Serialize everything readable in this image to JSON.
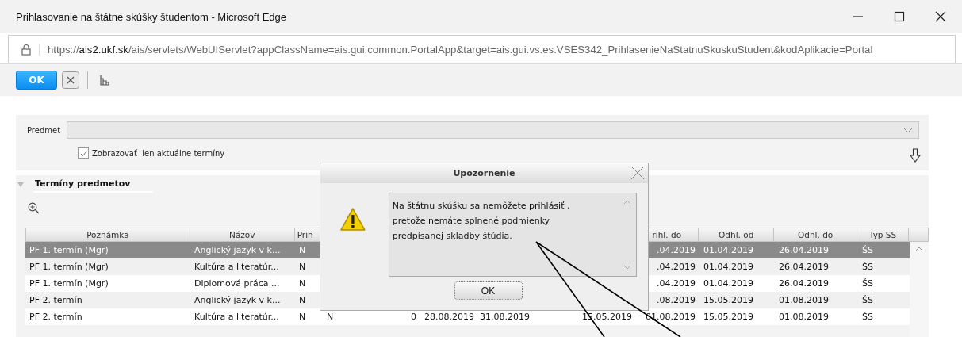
{
  "browser": {
    "title": "Prihlasovanie na štátne skúšky študentom - Microsoft Edge",
    "url_prefix": "https://",
    "url_host": "ais2.ukf.sk",
    "url_rest": "/ais/servlets/WebUIServlet?appClassName=ais.gui.common.PortalApp&target=ais.gui.vs.es.VSES342_PrihlasenieNaStatnuSkuskuStudent&kodAplikacie=Portal"
  },
  "toolbar": {
    "ok_label": "OK"
  },
  "form": {
    "subject_label": "Predmet",
    "current_only": {
      "label": "Zobrazovať  len aktuálne termíny",
      "checked": true
    }
  },
  "section": {
    "title": "Termíny predmetov",
    "expanded": true
  },
  "table": {
    "columns": [
      "Poznámka",
      "Názov",
      "Prih",
      null,
      null,
      null,
      null,
      null,
      "rihl. do",
      "Odhl. od",
      "Odhl. do",
      "Typ SS"
    ],
    "rows": [
      {
        "selected": true,
        "cells": [
          "PF 1. termín (Mgr)",
          "Anglický jazyk v k...",
          "N",
          null,
          null,
          null,
          null,
          null,
          ".04.2019",
          "01.04.2019",
          "26.04.2019",
          "ŠS"
        ]
      },
      {
        "selected": false,
        "cells": [
          "PF 1. termín (Mgr)",
          "Kultúra a literatúr...",
          "N",
          null,
          null,
          null,
          null,
          null,
          ".04.2019",
          "01.04.2019",
          "26.04.2019",
          "ŠS"
        ]
      },
      {
        "selected": false,
        "cells": [
          "PF 1. termín (Mgr)",
          "Diplomová práca ...",
          "N",
          null,
          null,
          null,
          null,
          null,
          ".04.2019",
          "01.04.2019",
          "26.04.2019",
          "ŠS"
        ]
      },
      {
        "selected": false,
        "cells": [
          "PF 2. termín",
          "Anglický jazyk v k...",
          "N",
          null,
          null,
          null,
          null,
          null,
          ".08.2019",
          "15.05.2019",
          "01.08.2019",
          "ŠS"
        ]
      },
      {
        "selected": false,
        "cells": [
          "PF 2. termín",
          "Kultúra a literatúr...",
          "N",
          "N",
          "0",
          "28.08.2019",
          "31.08.2019",
          "15.05.2019",
          "01.08.2019",
          "15.05.2019",
          "01.08.2019",
          "ŠS"
        ]
      }
    ]
  },
  "dialog": {
    "title": "Upozornenie",
    "message": "Na štátnu skúšku sa nemôžete prihlásiť ,\npretože nemáte splnené podmienky\npredpísanej skladby štúdia.",
    "ok_label": "OK"
  }
}
